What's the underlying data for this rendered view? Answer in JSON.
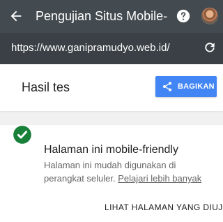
{
  "header": {
    "title": "Pengujian Situs Mobile-",
    "back_icon": "arrow-left-icon",
    "help_icon": "help-icon",
    "avatar": "avatar"
  },
  "url_bar": {
    "url": "https://www.ganipramudyo.web.id/",
    "refresh_icon": "refresh-icon"
  },
  "results": {
    "title": "Hasil tes",
    "share_label": "BAGIKAN",
    "share_icon": "share-icon",
    "accent_color": "#4285f4"
  },
  "card": {
    "status_icon": "check-circle-icon",
    "status_color": "#188038",
    "title": "Halaman ini mobile-friendly",
    "description": "Halaman ini mudah digunakan di perangkat seluler.",
    "learn_more": "Pelajari lebih banyak",
    "view_page_label": "LIHAT HALAMAN YANG DIUJI"
  }
}
